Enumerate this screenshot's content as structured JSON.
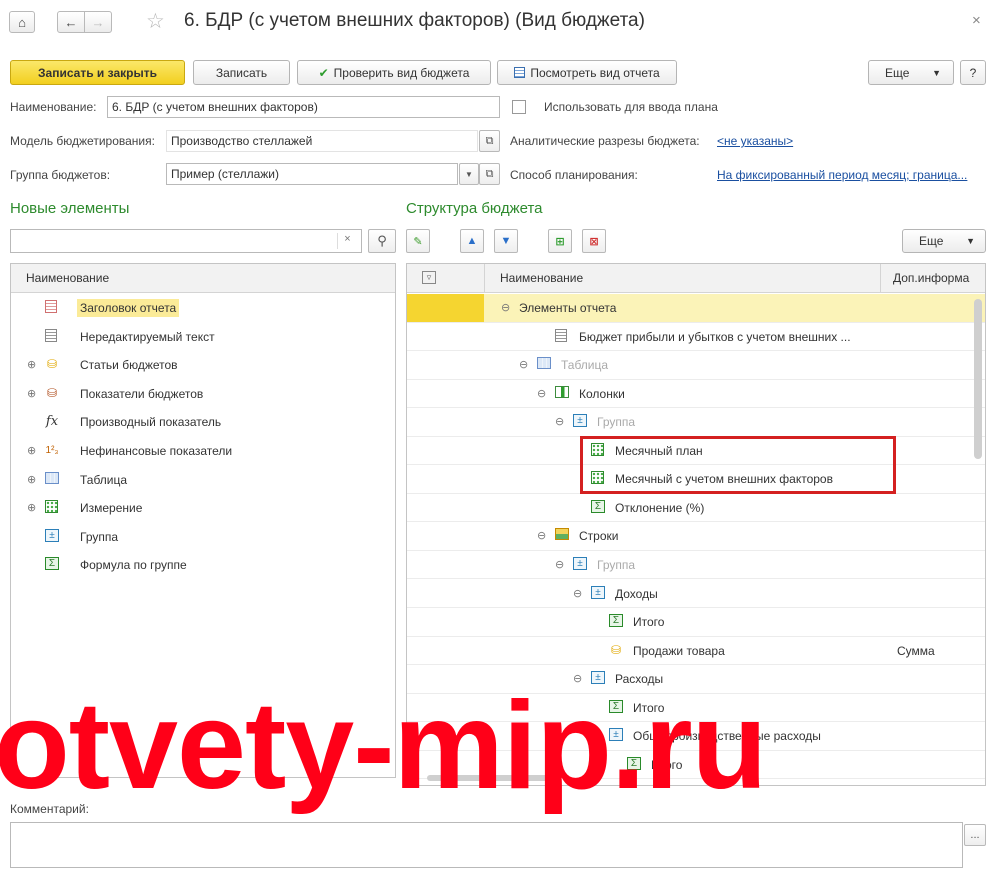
{
  "window": {
    "title": "6. БДР (с учетом внешних факторов) (Вид бюджета)",
    "close_glyph": "×"
  },
  "toolbar": {
    "save_close": "Записать и закрыть",
    "save": "Записать",
    "check": "Проверить вид бюджета",
    "view_report": "Посмотреть вид отчета",
    "more": "Еще",
    "help": "?"
  },
  "form": {
    "name_label": "Наименование:",
    "name_value": "6. БДР (с учетом внешних факторов)",
    "use_for_plan_label": "Использовать для ввода плана",
    "model_label": "Модель бюджетирования:",
    "model_value": "Производство стеллажей",
    "analytics_label": "Аналитические разрезы бюджета:",
    "analytics_value": "<не указаны>",
    "group_label": "Группа бюджетов:",
    "group_value": "Пример (стеллажи)",
    "planning_label": "Способ планирования:",
    "planning_value": "На фиксированный период месяц;  граница..."
  },
  "left_panel": {
    "title": "Новые элементы",
    "search_placeholder": "",
    "column_header": "Наименование",
    "items": [
      {
        "label": "Заголовок отчета",
        "icon": "report-header-icon",
        "expandable": false,
        "selected": true
      },
      {
        "label": "Нередактируемый текст",
        "icon": "text-icon",
        "expandable": false
      },
      {
        "label": "Статьи бюджетов",
        "icon": "budget-items-icon",
        "expandable": true
      },
      {
        "label": "Показатели бюджетов",
        "icon": "budget-indicators-icon",
        "expandable": true
      },
      {
        "label": "Производный показатель",
        "icon": "formula-fx-icon",
        "expandable": false
      },
      {
        "label": "Нефинансовые показатели",
        "icon": "nonfinancial-icon",
        "expandable": true
      },
      {
        "label": "Таблица",
        "icon": "table-icon",
        "expandable": true
      },
      {
        "label": "Измерение",
        "icon": "dimension-icon",
        "expandable": true
      },
      {
        "label": "Группа",
        "icon": "group-icon",
        "expandable": false
      },
      {
        "label": "Формула по группе",
        "icon": "sum-icon",
        "expandable": false
      }
    ]
  },
  "right_panel": {
    "title": "Структура бюджета",
    "more": "Еще",
    "col_name": "Наименование",
    "col_extra": "Доп.информа",
    "rows": [
      {
        "label": "Элементы отчета",
        "level": 0,
        "toggle": "⊖",
        "icon": "",
        "muted": false,
        "extra": "",
        "selected": true
      },
      {
        "label": "Бюджет прибыли и убытков с учетом внешних ...",
        "level": 2,
        "toggle": "",
        "icon": "text-icon",
        "muted": false,
        "extra": ""
      },
      {
        "label": "Таблица",
        "level": 1,
        "toggle": "⊖",
        "icon": "table-icon",
        "muted": true,
        "extra": ""
      },
      {
        "label": "Колонки",
        "level": 2,
        "toggle": "⊖",
        "icon": "columns-icon",
        "muted": false,
        "extra": ""
      },
      {
        "label": "Группа",
        "level": 3,
        "toggle": "⊖",
        "icon": "group-icon",
        "muted": true,
        "extra": ""
      },
      {
        "label": "Месячный план",
        "level": 4,
        "toggle": "",
        "icon": "dimension-icon",
        "muted": false,
        "extra": ""
      },
      {
        "label": "Месячный с учетом внешних факторов",
        "level": 4,
        "toggle": "",
        "icon": "dimension-icon",
        "muted": false,
        "extra": ""
      },
      {
        "label": "Отклонение (%)",
        "level": 4,
        "toggle": "",
        "icon": "sum-icon",
        "muted": false,
        "extra": ""
      },
      {
        "label": "Строки",
        "level": 2,
        "toggle": "⊖",
        "icon": "rows-icon",
        "muted": false,
        "extra": ""
      },
      {
        "label": "Группа",
        "level": 3,
        "toggle": "⊖",
        "icon": "group-icon",
        "muted": true,
        "extra": ""
      },
      {
        "label": "Доходы",
        "level": 4,
        "toggle": "⊖",
        "icon": "group-icon",
        "muted": false,
        "extra": ""
      },
      {
        "label": "Итого",
        "level": 5,
        "toggle": "",
        "icon": "sum-icon",
        "muted": false,
        "extra": ""
      },
      {
        "label": "Продажи товара",
        "level": 5,
        "toggle": "",
        "icon": "budget-items-icon",
        "muted": false,
        "extra": "Сумма"
      },
      {
        "label": "Расходы",
        "level": 4,
        "toggle": "⊖",
        "icon": "group-icon",
        "muted": false,
        "extra": ""
      },
      {
        "label": "Итого",
        "level": 5,
        "toggle": "",
        "icon": "sum-icon",
        "muted": false,
        "extra": ""
      },
      {
        "label": "Общепроизводственные расходы",
        "level": 5,
        "toggle": "⊖",
        "icon": "group-icon",
        "muted": false,
        "extra": ""
      },
      {
        "label": "Итого",
        "level": 6,
        "toggle": "",
        "icon": "sum-icon",
        "muted": false,
        "extra": ""
      }
    ]
  },
  "comment": {
    "label": "Комментарий:",
    "value": "",
    "ellipsis": "..."
  },
  "watermark": "otvety-mip.ru",
  "colors": {
    "accent_yellow": "#f5d530",
    "section_green": "#2e8b2e",
    "link_blue": "#1a4fa0",
    "highlight_red": "#d42020",
    "watermark_red": "#ff0018"
  }
}
